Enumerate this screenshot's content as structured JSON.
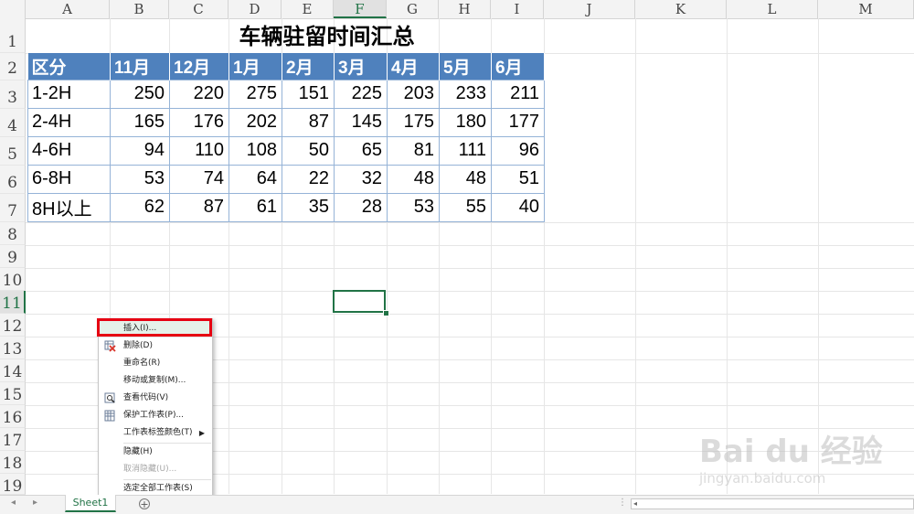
{
  "columns": [
    "A",
    "B",
    "C",
    "D",
    "E",
    "F",
    "G",
    "H",
    "I",
    "J",
    "K",
    "L",
    "M"
  ],
  "rows": [
    "1",
    "2",
    "3",
    "4",
    "5",
    "6",
    "7",
    "8",
    "9",
    "10",
    "11",
    "12",
    "13",
    "14",
    "15",
    "16",
    "17",
    "18",
    "19"
  ],
  "active_column": "F",
  "active_row": "11",
  "title": "车辆驻留时间汇总",
  "table": {
    "headers": [
      "区分",
      "11月",
      "12月",
      "1月",
      "2月",
      "3月",
      "4月",
      "5月",
      "6月"
    ],
    "rows": [
      {
        "label": "1-2H",
        "values": [
          "250",
          "220",
          "275",
          "151",
          "225",
          "203",
          "233",
          "211"
        ]
      },
      {
        "label": "2-4H",
        "values": [
          "165",
          "176",
          "202",
          "87",
          "145",
          "175",
          "180",
          "177"
        ]
      },
      {
        "label": "4-6H",
        "values": [
          "94",
          "110",
          "108",
          "50",
          "65",
          "81",
          "111",
          "96"
        ]
      },
      {
        "label": "6-8H",
        "values": [
          "53",
          "74",
          "64",
          "22",
          "32",
          "48",
          "48",
          "51"
        ]
      },
      {
        "label": "8H以上",
        "values": [
          "62",
          "87",
          "61",
          "35",
          "28",
          "53",
          "55",
          "40"
        ]
      }
    ]
  },
  "context_menu": {
    "items": [
      {
        "label": "插入(I)...",
        "icon": "",
        "disabled": false,
        "highlighted": true
      },
      {
        "label": "删除(D)",
        "icon": "delete-sheet-icon",
        "disabled": false
      },
      {
        "label": "重命名(R)",
        "icon": "",
        "disabled": false
      },
      {
        "label": "移动或复制(M)...",
        "icon": "",
        "disabled": false
      },
      {
        "label": "查看代码(V)",
        "icon": "view-code-icon",
        "disabled": false
      },
      {
        "label": "保护工作表(P)...",
        "icon": "protect-sheet-icon",
        "disabled": false
      },
      {
        "label": "工作表标签颜色(T)",
        "icon": "",
        "disabled": false,
        "submenu": true
      },
      {
        "label": "隐藏(H)",
        "icon": "",
        "disabled": false
      },
      {
        "label": "取消隐藏(U)...",
        "icon": "",
        "disabled": true
      },
      {
        "label": "选定全部工作表(S)",
        "icon": "",
        "disabled": false
      }
    ]
  },
  "sheet_tab": "Sheet1",
  "watermark": {
    "logo": "Bai du 经验",
    "url": "jingyan.baidu.com"
  },
  "colors": {
    "header_blue": "#4f81bd",
    "excel_green": "#217346",
    "highlight_red": "#e60012"
  }
}
